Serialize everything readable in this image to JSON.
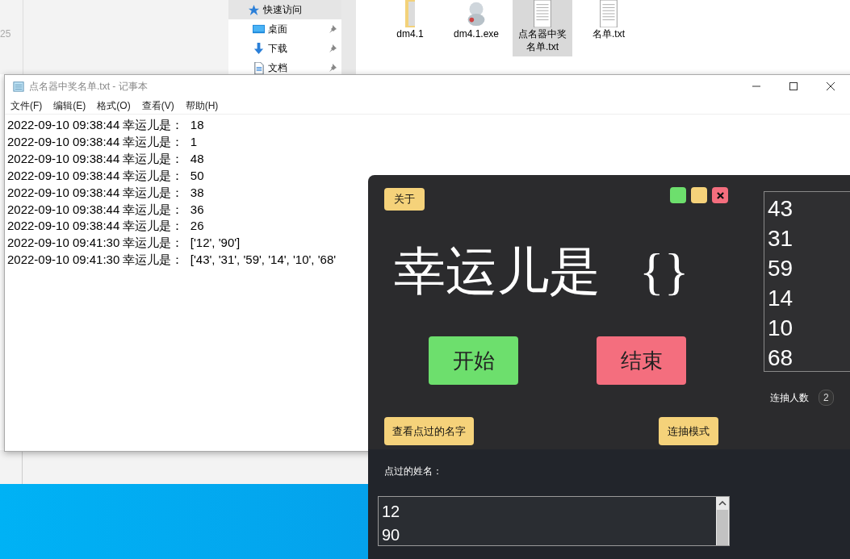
{
  "explorer": {
    "side_number": "25",
    "nav_items": [
      {
        "label": "快速访问",
        "kind": "star",
        "selected": true,
        "pinned": false
      },
      {
        "label": "桌面",
        "kind": "desktop",
        "selected": false,
        "pinned": true
      },
      {
        "label": "下载",
        "kind": "download",
        "selected": false,
        "pinned": true
      },
      {
        "label": "文档",
        "kind": "document",
        "selected": false,
        "pinned": true
      }
    ],
    "files": [
      {
        "name": "dm4.1",
        "kind": "folder",
        "selected": false
      },
      {
        "name": "dm4.1.exe",
        "kind": "program",
        "selected": false
      },
      {
        "name": "点名器中奖名单.txt",
        "kind": "text",
        "selected": true
      },
      {
        "name": "名单.txt",
        "kind": "text",
        "selected": false
      }
    ]
  },
  "notepad": {
    "title": "点名器中奖名单.txt - 记事本",
    "menu": [
      "文件(F)",
      "编辑(E)",
      "格式(O)",
      "查看(V)",
      "帮助(H)"
    ],
    "lines": [
      "2022-09-10 09:38:44 幸运儿是：  18",
      "2022-09-10 09:38:44 幸运儿是：  1",
      "2022-09-10 09:38:44 幸运儿是：  48",
      "2022-09-10 09:38:44 幸运儿是：  50",
      "2022-09-10 09:38:44 幸运儿是：  38",
      "2022-09-10 09:38:44 幸运儿是：  36",
      "2022-09-10 09:38:44 幸运儿是：  26",
      "2022-09-10 09:41:30 幸运儿是：  ['12', '90']",
      "2022-09-10 09:41:30 幸运儿是：  ['43', '31', '59', '14', '10', '68'"
    ]
  },
  "app": {
    "about_button": "关于",
    "window_buttons": [
      {
        "kind": "plain",
        "color": "#6ddf6d"
      },
      {
        "kind": "plain",
        "color": "#f5d27a"
      },
      {
        "kind": "close",
        "color": "#f46e7e"
      }
    ],
    "headline": "幸运儿是",
    "headline_braces": "{}",
    "draw_list": [
      "43",
      "31",
      "59",
      "14",
      "10",
      "68"
    ],
    "start_button": "开始",
    "stop_button": "结束",
    "count_label": "连抽人数",
    "count_value": "2",
    "history_button": "查看点过的名字",
    "multi_button": "连抽模式",
    "history_label": "点过的姓名：",
    "history": [
      "12",
      "90"
    ]
  }
}
